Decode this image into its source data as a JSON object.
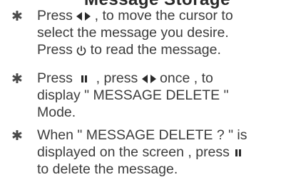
{
  "heading_fragment": "Message Storage",
  "instructions": [
    {
      "bullet": "✱",
      "lines": [
        [
          "Press ",
          "{arrows}",
          " , to move the cursor to"
        ],
        [
          "select the message you desire."
        ],
        [
          "Press ",
          "{power}",
          " to read the message."
        ]
      ]
    },
    {
      "bullet": "✱",
      "lines": [
        [
          "Press ",
          "{pause}",
          " , press ",
          "{arrows}",
          " once , to"
        ],
        [
          "display \" MESSAGE DELETE \""
        ],
        [
          "Mode."
        ]
      ]
    },
    {
      "bullet": "✱",
      "lines": [
        [
          "When \" MESSAGE DELETE ? \" is"
        ],
        [
          "displayed on the screen , press ",
          "{pause}"
        ],
        [
          "to delete  the message."
        ]
      ]
    }
  ],
  "icons": {
    "arrows": "left-right-arrows-icon",
    "power": "power-icon",
    "pause": "pause-icon"
  }
}
